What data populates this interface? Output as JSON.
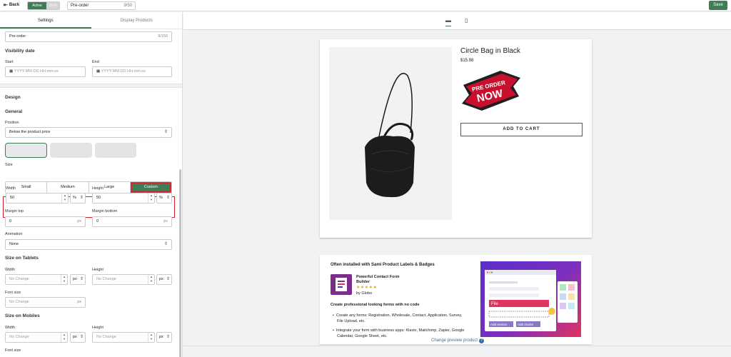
{
  "topbar": {
    "back_label": "Back",
    "status_active": "Active",
    "status_inactive": "Draft",
    "title_value": "Pre-order",
    "title_count": "9/50",
    "save_label": "Save"
  },
  "tabs": [
    "Settings",
    "Display Products"
  ],
  "settings": {
    "label_name": "Pre-order",
    "label_name_count": "9/150",
    "visibility_heading": "Visibility date",
    "start_label": "Start",
    "end_label": "End",
    "date_placeholder": "YYYY-MM-DD HH:mm:ss"
  },
  "design": {
    "heading": "Design",
    "general_heading": "General",
    "position_label": "Position",
    "position_value": "Below the product price",
    "size_label": "Size",
    "size_options": [
      "Small",
      "Medium",
      "Large",
      "Custom"
    ],
    "size_selected": "Custom",
    "width_label": "Width",
    "width_value": "50",
    "width_unit": "%",
    "height_label": "Height",
    "height_value": "50",
    "height_unit": "%",
    "margin_top_label": "Margin top",
    "margin_top_value": "0",
    "margin_bottom_label": "Margin bottom",
    "margin_bottom_value": "0",
    "margin_unit": "px",
    "animation_label": "Animation",
    "animation_value": "None"
  },
  "tablets": {
    "heading": "Size on Tablets",
    "width_label": "Width",
    "height_label": "Height",
    "no_change": "No Change",
    "unit": "px",
    "font_size_label": "Font size"
  },
  "mobiles": {
    "heading": "Size on Mobiles",
    "width_label": "Width",
    "height_label": "Height",
    "no_change": "No Change",
    "unit": "px",
    "font_size_label": "Font size"
  },
  "preview": {
    "product_title": "Circle Bag in Black",
    "price": "$15.98",
    "badge_line1": "PRE ORDER",
    "badge_line2": "NOW",
    "add_to_cart": "ADD TO CART",
    "change_preview": "Change preview product"
  },
  "promo": {
    "heading": "Often installed with Sami Product Labels & Badges",
    "app_name_line1": "Powerful Contact Form",
    "app_name_line2": "Builder",
    "stars": "★★★★★",
    "by": "by Globo",
    "tagline": "Create professional looking forms with no code",
    "bullet1_line1": "Create any forms: Registration, Wholesale, Contact, Application, Survey,",
    "bullet1_line2": "File Upload, etc.",
    "bullet2_line1": "Integrate your form with business apps: Klavio, Mailchimp, Zapier, Google",
    "bullet2_line2": "Calendar, Google Sheet, etc.",
    "img_file": "File",
    "img_add_section": "Add section",
    "img_add_divider": "Add divider"
  },
  "colors": {
    "accent": "#3f7d56",
    "highlight": "#d0202a",
    "badge_red": "#c8102e"
  }
}
